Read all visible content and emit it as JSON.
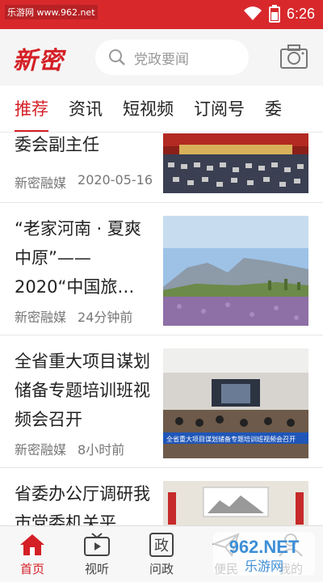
{
  "status": {
    "watermark": "乐游网 www.962.net",
    "time": "6:26"
  },
  "header": {
    "logo": "新密",
    "search_placeholder": "党政要闻"
  },
  "tabs": [
    {
      "label": "推荐",
      "active": true
    },
    {
      "label": "资讯"
    },
    {
      "label": "短视频"
    },
    {
      "label": "订阅号"
    },
    {
      "label": "委"
    }
  ],
  "feed": [
    {
      "title": "委会副主任",
      "source": "新密融媒",
      "time": "2020-05-16"
    },
    {
      "title": "“老家河南 · 夏爽中原”——2020“中国旅…",
      "source": "新密融媒",
      "time": "24分钟前"
    },
    {
      "title": "全省重大项目谋划储备专题培训班视频会召开",
      "source": "新密融媒",
      "time": "8小时前",
      "caption": "全省重大项目谋划储备专题培训班视频会召开"
    },
    {
      "title": "省委办公厅调研我市党委机关平",
      "source": "",
      "time": ""
    }
  ],
  "nav": [
    {
      "label": "首页",
      "active": true,
      "icon": "home-icon"
    },
    {
      "label": "视听",
      "icon": "tv-icon"
    },
    {
      "label": "问政",
      "icon": "zheng-icon",
      "glyph": "政"
    },
    {
      "label": "便民",
      "icon": "paper-plane-icon"
    },
    {
      "label": "我的",
      "icon": "user-icon"
    }
  ],
  "watermark_bottom": "962.NET",
  "watermark_bottom_sub": "乐游网",
  "colors": {
    "brand": "#d41f26",
    "statusbar": "#d8282c"
  }
}
